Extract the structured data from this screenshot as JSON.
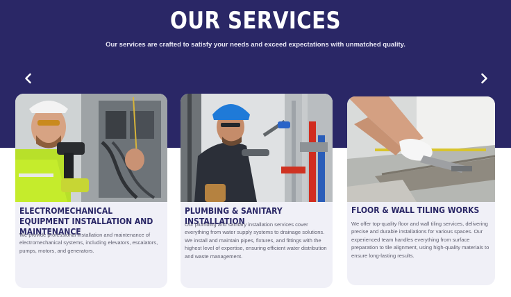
{
  "section": {
    "title": "OUR SERVICES",
    "subtitle": "Our services are crafted to satisfy your needs and exceed expectations with unmatched quality."
  },
  "carousel": {
    "prev_icon": "chevron-left-icon",
    "next_icon": "chevron-right-icon"
  },
  "colors": {
    "hero_bg": "#2a2766",
    "card_bg": "#f0f0f7",
    "title_text": "#2a2766",
    "body_text": "#5e5e6e"
  },
  "cards": [
    {
      "image": "electrician-working-on-panel-photo",
      "title": "ELECTROMECHANICAL EQUIPMENT INSTALLATION AND MAINTENANCE",
      "description": "We provide professional installation and maintenance of electromechanical systems, including elevators, escalators, pumps, motors, and generators."
    },
    {
      "image": "plumber-with-wrench-photo",
      "title": "PLUMBING & SANITARY INSTALLATION",
      "description": "Our plumbing and sanitary installation services cover everything from water supply systems to drainage solutions. We install and maintain pipes, fixtures, and fittings with the highest level of expertise, ensuring efficient water distribution and waste management."
    },
    {
      "image": "floor-tiling-photo",
      "title": "FLOOR & WALL TILING WORKS",
      "description": "We offer top-quality floor and wall tiling services, delivering precise and durable installations for various spaces. Our experienced team handles everything from surface preparation to tile alignment, using high-quality materials to ensure long-lasting results."
    }
  ]
}
